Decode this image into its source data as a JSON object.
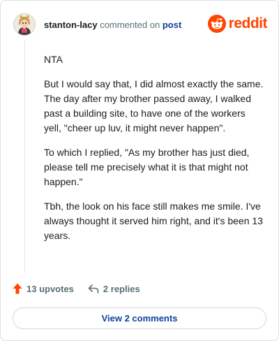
{
  "comment": {
    "author": "stanton-lacy",
    "action_text": "commented on",
    "post_link": "post",
    "paragraphs": [
      "NTA",
      "But I would say that, I did almost exactly the same. The day after my brother passed away, I walked past a building site, to have one of the workers yell, \"cheer up luv, it might never happen\".",
      "To which I replied, \"As my brother has just died, please tell me precisely what it is that might not happen.\"",
      "Tbh, the look on his face still makes me smile. I've always thought it served him right, and it's been 13 years."
    ]
  },
  "brand": {
    "name": "reddit",
    "color": "#ff4500"
  },
  "actions": {
    "upvotes_label": "13 upvotes",
    "replies_label": "2 replies"
  },
  "footer": {
    "view_comments_label": "View 2 comments"
  },
  "icons": {
    "avatar": "avatar-image",
    "logo": "reddit-alien-icon",
    "upvote": "upvote-arrow-icon",
    "reply": "reply-arrow-icon"
  },
  "colors": {
    "link": "#0a449b",
    "muted": "#576f76",
    "text": "#1c1c1c",
    "upvote": "#ff4500"
  }
}
